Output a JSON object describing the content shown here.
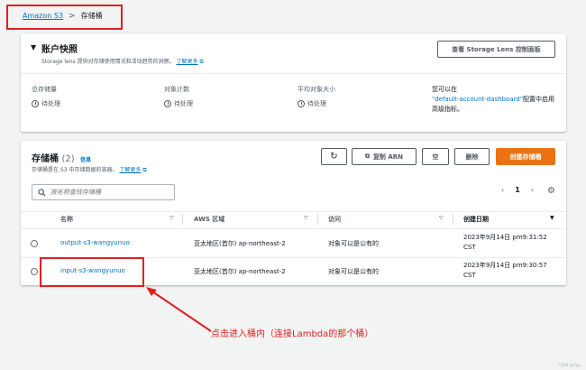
{
  "breadcrumb": {
    "root": "Amazon S3",
    "current": "存储桶"
  },
  "snapshot": {
    "title": "账户快照",
    "description": "Storage lens 提供对存储使用情况和活动趋势的洞察。",
    "learn_more": "了解更多",
    "lens_button": "查看 Storage Lens 控制面板",
    "metrics": [
      {
        "label": "总存储量",
        "value": "待处理"
      },
      {
        "label": "对象计数",
        "value": "待处理"
      },
      {
        "label": "平均对象大小",
        "value": "待处理"
      }
    ],
    "note_prefix": "您可以在",
    "note_link": "\"default-account-dashboard\"",
    "note_suffix": "配置中启用高级指标。"
  },
  "buckets": {
    "title": "存储桶",
    "count": "(2)",
    "info": "信息",
    "description": "存储桶是在 S3 中存储数据的容器。",
    "learn_more": "了解更多",
    "buttons": {
      "refresh": "↻",
      "copy_arn": "复制 ARN",
      "empty": "空",
      "delete": "删除",
      "create": "创建存储桶"
    },
    "search_placeholder": "按名称查找存储桶",
    "page": "1",
    "columns": {
      "name": "名称",
      "region": "AWS 区域",
      "access": "访问",
      "created": "创建日期"
    },
    "rows": [
      {
        "name": "output-s3-wangyunuo",
        "region": "亚太地区(首尔) ap-northeast-2",
        "access": "对象可以是公有的",
        "date1": "2023年9月14日 pm9:31:52",
        "date2": "CST"
      },
      {
        "name": "input-s3-wangyunuo",
        "region": "亚太地区(首尔) ap-northeast-2",
        "access": "对象可以是公有的",
        "date1": "2023年9月14日 pm9:30:57",
        "date2": "CST"
      }
    ]
  },
  "annotation": "点击进入桶内（连接Lambda的那个桶）",
  "watermark": "CSDN @Opp_",
  "colors": {
    "accent": "#ec7211",
    "link": "#0073bb",
    "annotation": "#e02020"
  }
}
